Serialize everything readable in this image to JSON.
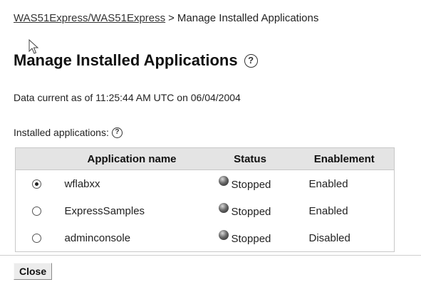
{
  "breadcrumb": {
    "link": "WAS51Express/WAS51Express",
    "separator": ">",
    "current": "Manage Installed Applications"
  },
  "page": {
    "title": "Manage Installed Applications",
    "help_glyph": "?",
    "data_current": "Data current as of 11:25:44 AM UTC on 06/04/2004"
  },
  "table": {
    "caption": "Installed applications:",
    "help_glyph": "?",
    "columns": [
      "",
      "Application name",
      "Status",
      "Enablement"
    ],
    "rows": [
      {
        "selected": true,
        "name": "wflabxx",
        "status": "Stopped",
        "enablement": "Enabled"
      },
      {
        "selected": false,
        "name": "ExpressSamples",
        "status": "Stopped",
        "enablement": "Enabled"
      },
      {
        "selected": false,
        "name": "adminconsole",
        "status": "Stopped",
        "enablement": "Disabled"
      }
    ]
  },
  "footer": {
    "close_label": "Close"
  },
  "icons": {
    "help": "help-icon",
    "status": "stopped-status-icon",
    "cursor": "mouse-pointer-icon"
  },
  "colors": {
    "header_background": "#e4e4e4",
    "table_border": "#c8c8c8",
    "button_background": "#ececec"
  }
}
